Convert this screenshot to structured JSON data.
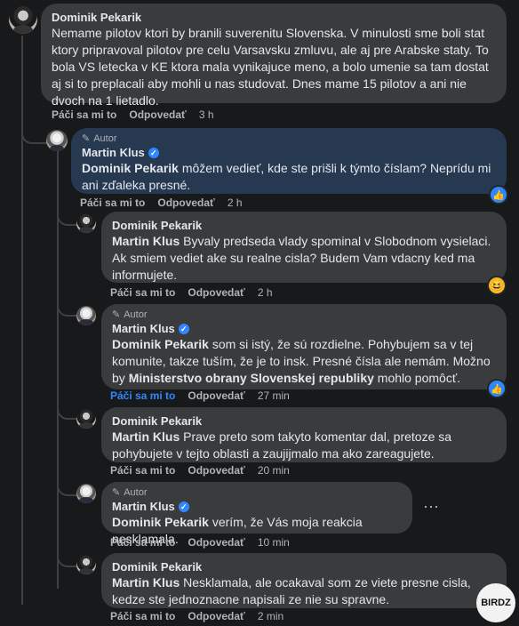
{
  "comments": [
    {
      "author": "Dominik Pekarik",
      "author_badge": "",
      "text": "Nemame pilotov ktori by branili suverenitu Slovenska. V minulosti sme boli stat ktory pripravoval pilotov pre celu Varsavsku zmluvu, ale aj pre Arabske staty. To bola VS letecka v KE ktora mala vynikajuce meno, a bolo umenie sa tam dostat aj si to preplacali aby mohli u nas studovat. Dnes mame 15 pilotov a ani nie dvoch na 1 lietadlo.",
      "like_label": "Páči sa mi to",
      "reply_label": "Odpovedať",
      "time": "3 h"
    },
    {
      "author": "Martin Klus",
      "author_badge": "Autor",
      "mention": "Dominik Pekarik",
      "text": " môžem vedieť, kde ste prišli k týmto číslam? Neprídu mi ani zďaleka presné.",
      "like_label": "Páči sa mi to",
      "reply_label": "Odpovedať",
      "time": "2 h",
      "reaction": "like-icon"
    },
    {
      "author": "Dominik Pekarik",
      "mention": "Martin Klus",
      "text": " Byvaly predseda vlady spominal v Slobodnom vysielaci. Ak smiem vediet ake su realne cisla? Budem Vam vdacny ked ma informujete.",
      "like_label": "Páči sa mi to",
      "reply_label": "Odpovedať",
      "time": "2 h",
      "reaction": "haha-icon"
    },
    {
      "author": "Martin Klus",
      "author_badge": "Autor",
      "mention": "Dominik Pekarik",
      "text_a": " som si istý, že sú rozdielne. Pohybujem sa v tej komunite, takze tuším, že je to insk. Presné čísla ale nemám. Možno by ",
      "mention2": "Ministerstvo obrany Slovenskej republiky",
      "text_b": " mohlo pomôcť.",
      "like_label": "Páči sa mi to",
      "reply_label": "Odpovedať",
      "time": "27 min",
      "reaction": "like-icon"
    },
    {
      "author": "Dominik Pekarik",
      "mention": "Martin Klus",
      "text": " Prave preto som takyto komentar dal, pretoze sa pohybujete v tejto oblasti a zaujijmalo ma ako zareagujete.",
      "like_label": "Páči sa mi to",
      "reply_label": "Odpovedať",
      "time": "20 min"
    },
    {
      "author": "Martin Klus",
      "author_badge": "Autor",
      "mention": "Dominik Pekarik",
      "text": " verím, že Vás moja reakcia nesklamala.",
      "like_label": "Páči sa mi to",
      "reply_label": "Odpovedať",
      "time": "10 min",
      "more": "⋯"
    },
    {
      "author": "Dominik Pekarik",
      "mention": "Martin Klus",
      "text": " Nesklamala, ale ocakaval som ze viete presne cisla, kedze ste jednoznacne napisali ze nie su spravne.",
      "like_label": "Páči sa mi to",
      "reply_label": "Odpovedať",
      "time": "2 min"
    }
  ],
  "watermark": "BIRDZ",
  "colors": {
    "background": "#18191a",
    "bubble": "#3a3b3c",
    "bubble_highlight": "#263951",
    "accent": "#2d88ff",
    "secondary_text": "#b0b3b8"
  }
}
